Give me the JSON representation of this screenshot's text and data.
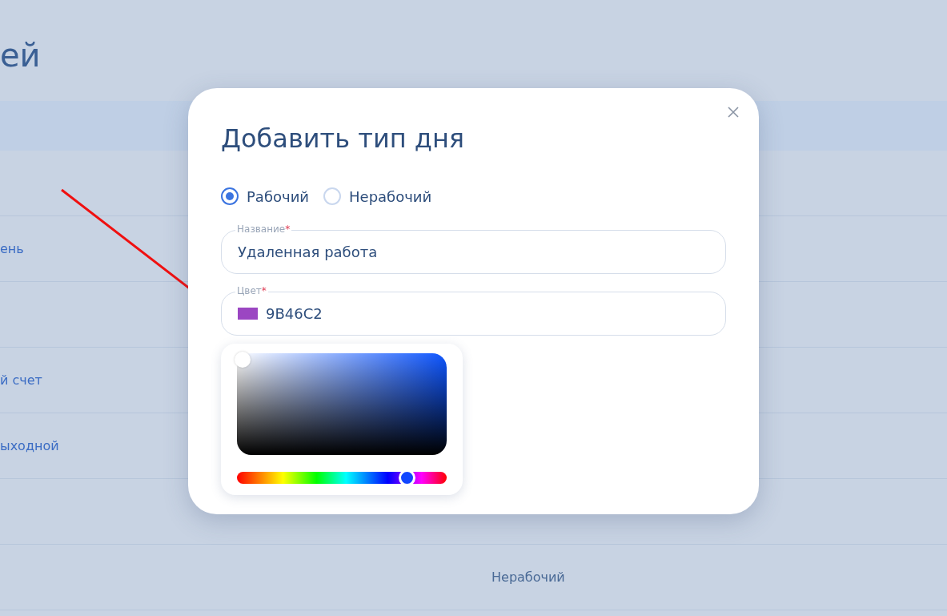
{
  "page": {
    "title": "ей"
  },
  "table": {
    "rows": [
      {},
      {
        "column_1": "ень"
      },
      {},
      {
        "column_1": "й счет"
      },
      {
        "column_1": "ыходной"
      },
      {},
      {
        "column_2": "Нерабочий"
      }
    ]
  },
  "dialog": {
    "title": "Добавить тип дня",
    "day_types": [
      {
        "label": "Рабочий",
        "selected": true
      },
      {
        "label": "Нерабочий",
        "selected": false
      }
    ],
    "fields": [
      {
        "kind": "text",
        "label": "Название",
        "required_mark": "*",
        "value": "Удаленная работа"
      },
      {
        "kind": "color",
        "label": "Цвет",
        "required_mark": "*",
        "value": "9B46C2",
        "color": "#9b46c2"
      }
    ],
    "color_picker": {
      "hue": {
        "level": 0.81
      }
    }
  }
}
